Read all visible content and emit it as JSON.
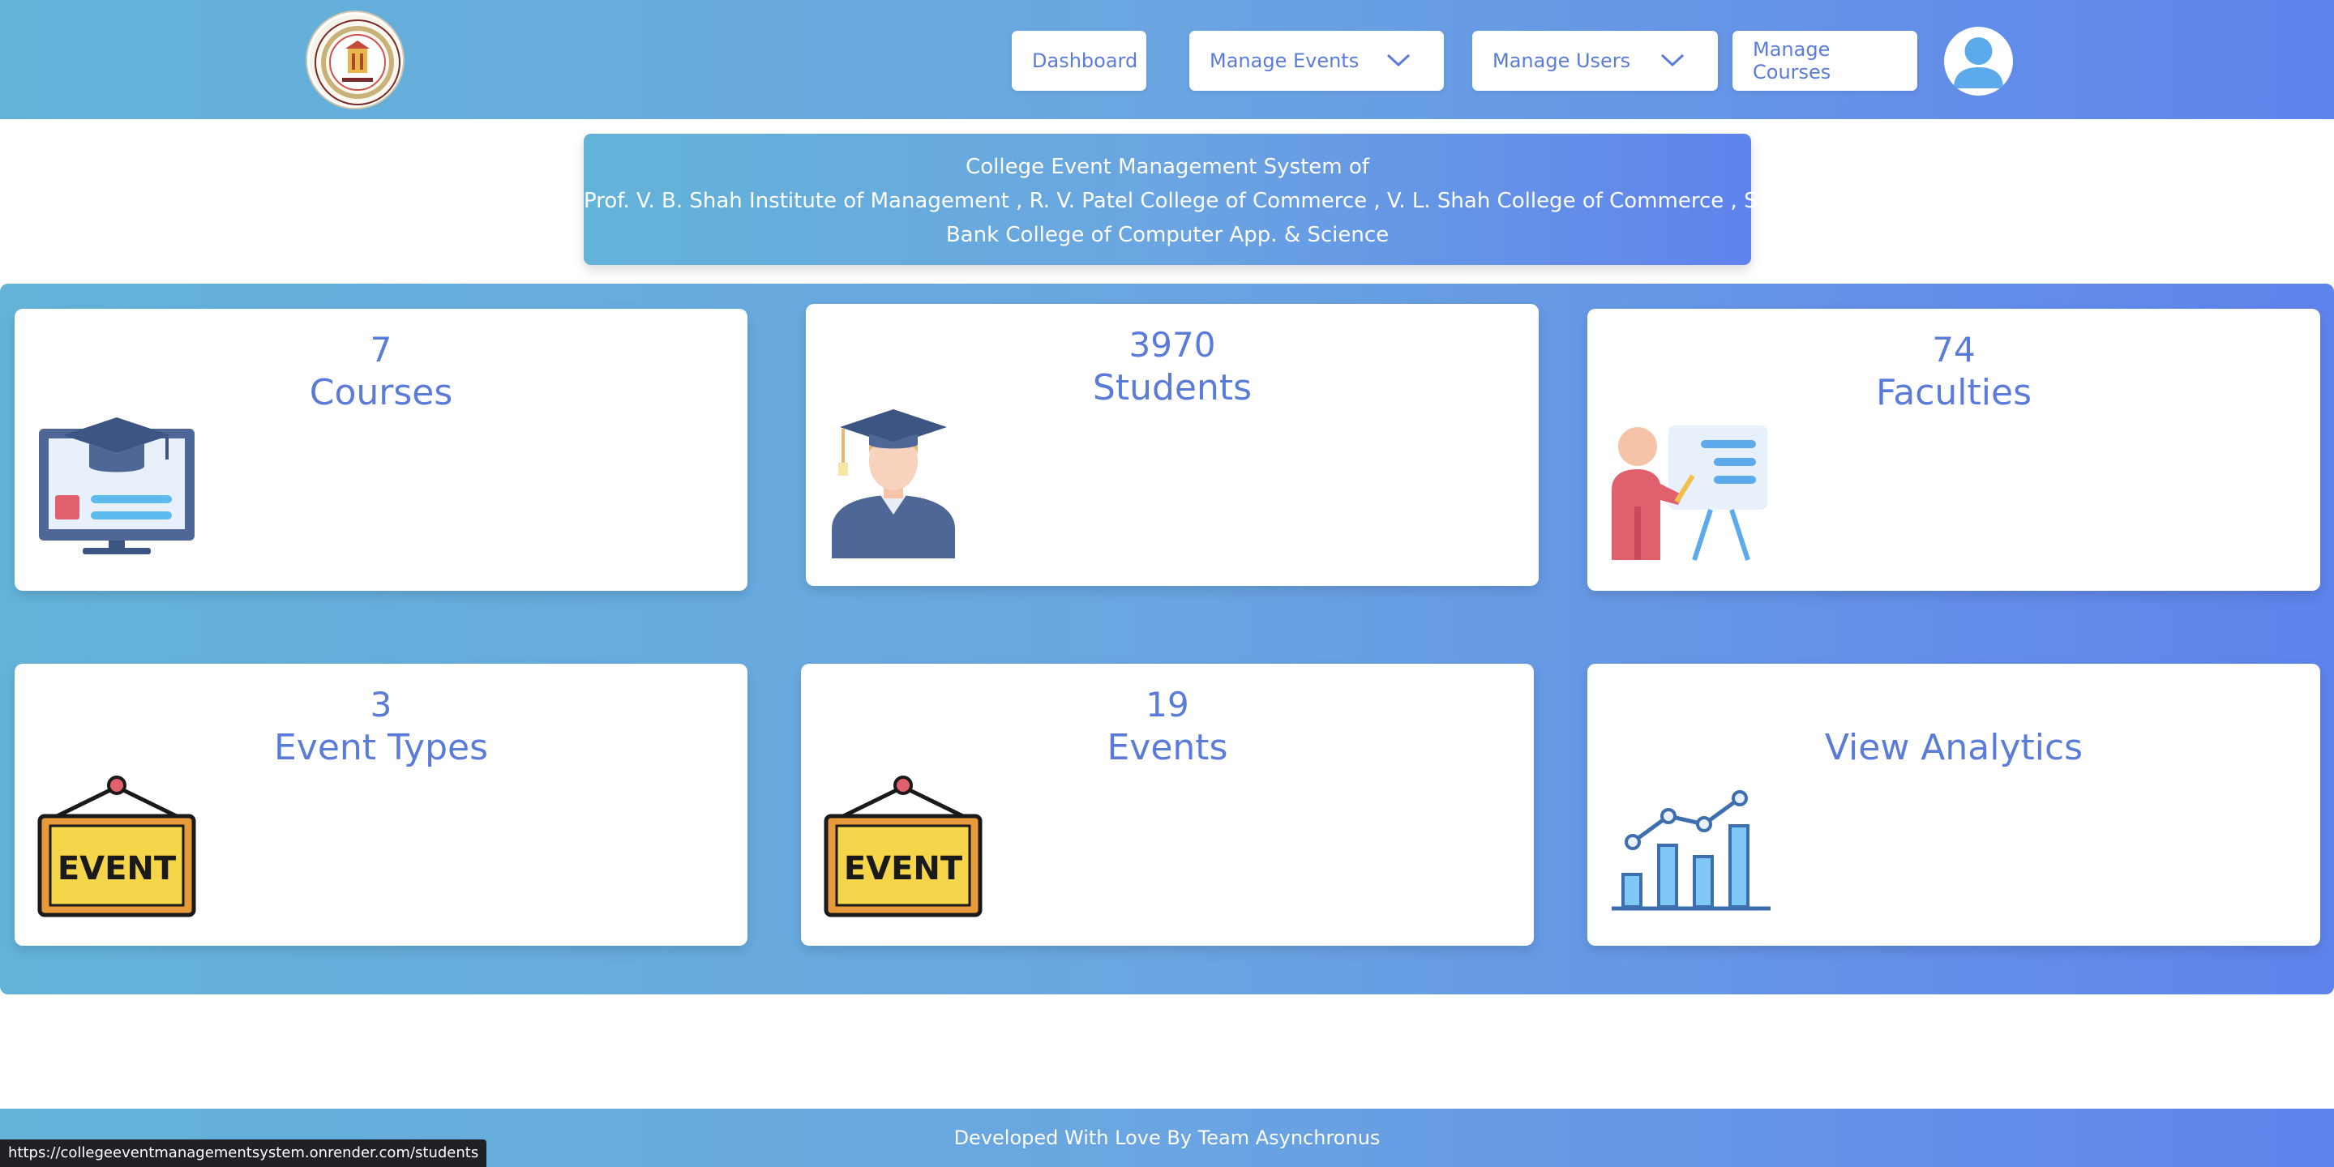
{
  "nav": {
    "dashboard": "Dashboard",
    "manage_events": "Manage Events",
    "manage_users": "Manage Users",
    "manage_courses": "Manage Courses",
    "logo_icon": "college-seal-logo",
    "profile_icon": "user-avatar-icon"
  },
  "banner": {
    "line1": "College Event Management System of",
    "line2": "Prof. V. B. Shah Institute of Management , R. V. Patel College of Commerce , V. L. Shah College of Commerce , Sutex",
    "line3": "Bank College of Computer App. & Science"
  },
  "cards": {
    "courses": {
      "count": "7",
      "label": "Courses",
      "icon": "courses-monitor-icon"
    },
    "students": {
      "count": "3970",
      "label": "Students",
      "icon": "graduate-student-icon"
    },
    "faculties": {
      "count": "74",
      "label": "Faculties",
      "icon": "teacher-board-icon"
    },
    "event_types": {
      "count": "3",
      "label": "Event Types",
      "icon": "event-sign-icon"
    },
    "events": {
      "count": "19",
      "label": "Events",
      "icon": "event-sign-icon"
    },
    "analytics": {
      "label": "View Analytics",
      "icon": "analytics-chart-icon"
    }
  },
  "footer": {
    "text": "Developed With Love By Team Asynchronus"
  },
  "status_bar": {
    "url": "https://collegeeventmanagementsystem.onrender.com/students"
  },
  "colors": {
    "accent": "#5b7bd9",
    "gradient_start": "#63b3d9",
    "gradient_end": "#5f83ec"
  }
}
